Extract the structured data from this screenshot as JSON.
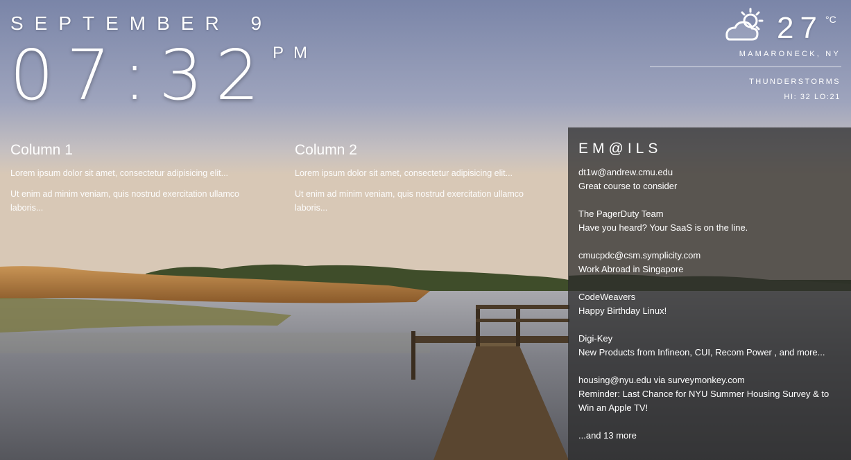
{
  "date": {
    "month": "SEPTEMBER",
    "day": "9"
  },
  "clock": {
    "time": "07:32",
    "ampm": "PM"
  },
  "weather": {
    "icon": "thunderstorm-icon",
    "temperature": "27",
    "unit": "°C",
    "location": "MAMARONECK, NY",
    "condition": "THUNDERSTORMS",
    "hilo": "HI: 32 LO:21"
  },
  "columns": [
    {
      "title": "Column 1",
      "paragraphs": [
        "Lorem ipsum dolor sit amet, consectetur adipisicing elit...",
        "Ut enim ad minim veniam, quis nostrud exercitation ullamco laboris..."
      ]
    },
    {
      "title": "Column 2",
      "paragraphs": [
        "Lorem ipsum dolor sit amet, consectetur adipisicing elit...",
        "Ut enim ad minim veniam, quis nostrud exercitation ullamco laboris..."
      ]
    }
  ],
  "emails": {
    "title": "EM@ILS",
    "items": [
      {
        "sender": "dt1w@andrew.cmu.edu",
        "subject": "Great course to consider"
      },
      {
        "sender": "The PagerDuty Team",
        "subject": "Have you heard? Your SaaS is on the line."
      },
      {
        "sender": "cmucpdc@csm.symplicity.com",
        "subject": "Work Abroad in Singapore"
      },
      {
        "sender": "CodeWeavers",
        "subject": "Happy Birthday Linux!"
      },
      {
        "sender": "Digi-Key",
        "subject": "New Products from Infineon, CUI, Recom Power , and more..."
      },
      {
        "sender": "housing@nyu.edu via surveymonkey.com",
        "subject": "Reminder: Last Chance for NYU Summer Housing Survey & to Win an Apple TV!"
      }
    ],
    "more": "...and 13 more"
  }
}
